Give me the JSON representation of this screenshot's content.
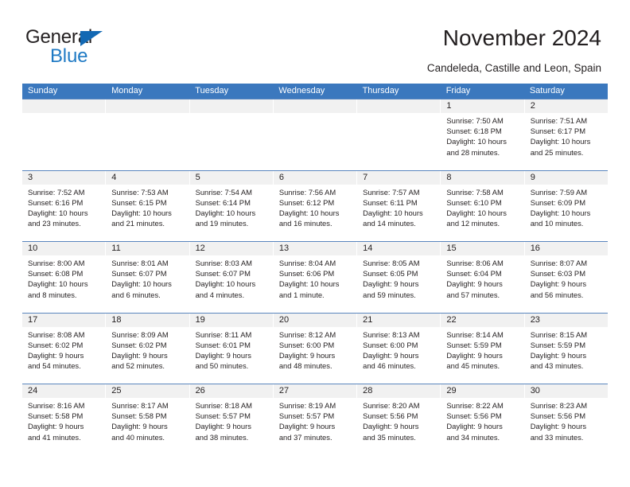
{
  "brand": {
    "name_part1": "General",
    "name_part2": "Blue",
    "triangle_color": "#1268b3",
    "blue_text_color": "#1f7ac4"
  },
  "header": {
    "title": "November 2024",
    "subtitle": "Candeleda, Castille and Leon, Spain"
  },
  "theme": {
    "header_row_bg": "#3b78be",
    "daynum_bg": "#f1f1f1",
    "week_separator": "#5a86be",
    "text_color": "#231f20"
  },
  "weekdays": [
    "Sunday",
    "Monday",
    "Tuesday",
    "Wednesday",
    "Thursday",
    "Friday",
    "Saturday"
  ],
  "weeks": [
    [
      {
        "day": "",
        "sunrise": "",
        "sunset": "",
        "daylight1": "",
        "daylight2": ""
      },
      {
        "day": "",
        "sunrise": "",
        "sunset": "",
        "daylight1": "",
        "daylight2": ""
      },
      {
        "day": "",
        "sunrise": "",
        "sunset": "",
        "daylight1": "",
        "daylight2": ""
      },
      {
        "day": "",
        "sunrise": "",
        "sunset": "",
        "daylight1": "",
        "daylight2": ""
      },
      {
        "day": "",
        "sunrise": "",
        "sunset": "",
        "daylight1": "",
        "daylight2": ""
      },
      {
        "day": "1",
        "sunrise": "Sunrise: 7:50 AM",
        "sunset": "Sunset: 6:18 PM",
        "daylight1": "Daylight: 10 hours",
        "daylight2": "and 28 minutes."
      },
      {
        "day": "2",
        "sunrise": "Sunrise: 7:51 AM",
        "sunset": "Sunset: 6:17 PM",
        "daylight1": "Daylight: 10 hours",
        "daylight2": "and 25 minutes."
      }
    ],
    [
      {
        "day": "3",
        "sunrise": "Sunrise: 7:52 AM",
        "sunset": "Sunset: 6:16 PM",
        "daylight1": "Daylight: 10 hours",
        "daylight2": "and 23 minutes."
      },
      {
        "day": "4",
        "sunrise": "Sunrise: 7:53 AM",
        "sunset": "Sunset: 6:15 PM",
        "daylight1": "Daylight: 10 hours",
        "daylight2": "and 21 minutes."
      },
      {
        "day": "5",
        "sunrise": "Sunrise: 7:54 AM",
        "sunset": "Sunset: 6:14 PM",
        "daylight1": "Daylight: 10 hours",
        "daylight2": "and 19 minutes."
      },
      {
        "day": "6",
        "sunrise": "Sunrise: 7:56 AM",
        "sunset": "Sunset: 6:12 PM",
        "daylight1": "Daylight: 10 hours",
        "daylight2": "and 16 minutes."
      },
      {
        "day": "7",
        "sunrise": "Sunrise: 7:57 AM",
        "sunset": "Sunset: 6:11 PM",
        "daylight1": "Daylight: 10 hours",
        "daylight2": "and 14 minutes."
      },
      {
        "day": "8",
        "sunrise": "Sunrise: 7:58 AM",
        "sunset": "Sunset: 6:10 PM",
        "daylight1": "Daylight: 10 hours",
        "daylight2": "and 12 minutes."
      },
      {
        "day": "9",
        "sunrise": "Sunrise: 7:59 AM",
        "sunset": "Sunset: 6:09 PM",
        "daylight1": "Daylight: 10 hours",
        "daylight2": "and 10 minutes."
      }
    ],
    [
      {
        "day": "10",
        "sunrise": "Sunrise: 8:00 AM",
        "sunset": "Sunset: 6:08 PM",
        "daylight1": "Daylight: 10 hours",
        "daylight2": "and 8 minutes."
      },
      {
        "day": "11",
        "sunrise": "Sunrise: 8:01 AM",
        "sunset": "Sunset: 6:07 PM",
        "daylight1": "Daylight: 10 hours",
        "daylight2": "and 6 minutes."
      },
      {
        "day": "12",
        "sunrise": "Sunrise: 8:03 AM",
        "sunset": "Sunset: 6:07 PM",
        "daylight1": "Daylight: 10 hours",
        "daylight2": "and 4 minutes."
      },
      {
        "day": "13",
        "sunrise": "Sunrise: 8:04 AM",
        "sunset": "Sunset: 6:06 PM",
        "daylight1": "Daylight: 10 hours",
        "daylight2": "and 1 minute."
      },
      {
        "day": "14",
        "sunrise": "Sunrise: 8:05 AM",
        "sunset": "Sunset: 6:05 PM",
        "daylight1": "Daylight: 9 hours",
        "daylight2": "and 59 minutes."
      },
      {
        "day": "15",
        "sunrise": "Sunrise: 8:06 AM",
        "sunset": "Sunset: 6:04 PM",
        "daylight1": "Daylight: 9 hours",
        "daylight2": "and 57 minutes."
      },
      {
        "day": "16",
        "sunrise": "Sunrise: 8:07 AM",
        "sunset": "Sunset: 6:03 PM",
        "daylight1": "Daylight: 9 hours",
        "daylight2": "and 56 minutes."
      }
    ],
    [
      {
        "day": "17",
        "sunrise": "Sunrise: 8:08 AM",
        "sunset": "Sunset: 6:02 PM",
        "daylight1": "Daylight: 9 hours",
        "daylight2": "and 54 minutes."
      },
      {
        "day": "18",
        "sunrise": "Sunrise: 8:09 AM",
        "sunset": "Sunset: 6:02 PM",
        "daylight1": "Daylight: 9 hours",
        "daylight2": "and 52 minutes."
      },
      {
        "day": "19",
        "sunrise": "Sunrise: 8:11 AM",
        "sunset": "Sunset: 6:01 PM",
        "daylight1": "Daylight: 9 hours",
        "daylight2": "and 50 minutes."
      },
      {
        "day": "20",
        "sunrise": "Sunrise: 8:12 AM",
        "sunset": "Sunset: 6:00 PM",
        "daylight1": "Daylight: 9 hours",
        "daylight2": "and 48 minutes."
      },
      {
        "day": "21",
        "sunrise": "Sunrise: 8:13 AM",
        "sunset": "Sunset: 6:00 PM",
        "daylight1": "Daylight: 9 hours",
        "daylight2": "and 46 minutes."
      },
      {
        "day": "22",
        "sunrise": "Sunrise: 8:14 AM",
        "sunset": "Sunset: 5:59 PM",
        "daylight1": "Daylight: 9 hours",
        "daylight2": "and 45 minutes."
      },
      {
        "day": "23",
        "sunrise": "Sunrise: 8:15 AM",
        "sunset": "Sunset: 5:59 PM",
        "daylight1": "Daylight: 9 hours",
        "daylight2": "and 43 minutes."
      }
    ],
    [
      {
        "day": "24",
        "sunrise": "Sunrise: 8:16 AM",
        "sunset": "Sunset: 5:58 PM",
        "daylight1": "Daylight: 9 hours",
        "daylight2": "and 41 minutes."
      },
      {
        "day": "25",
        "sunrise": "Sunrise: 8:17 AM",
        "sunset": "Sunset: 5:58 PM",
        "daylight1": "Daylight: 9 hours",
        "daylight2": "and 40 minutes."
      },
      {
        "day": "26",
        "sunrise": "Sunrise: 8:18 AM",
        "sunset": "Sunset: 5:57 PM",
        "daylight1": "Daylight: 9 hours",
        "daylight2": "and 38 minutes."
      },
      {
        "day": "27",
        "sunrise": "Sunrise: 8:19 AM",
        "sunset": "Sunset: 5:57 PM",
        "daylight1": "Daylight: 9 hours",
        "daylight2": "and 37 minutes."
      },
      {
        "day": "28",
        "sunrise": "Sunrise: 8:20 AM",
        "sunset": "Sunset: 5:56 PM",
        "daylight1": "Daylight: 9 hours",
        "daylight2": "and 35 minutes."
      },
      {
        "day": "29",
        "sunrise": "Sunrise: 8:22 AM",
        "sunset": "Sunset: 5:56 PM",
        "daylight1": "Daylight: 9 hours",
        "daylight2": "and 34 minutes."
      },
      {
        "day": "30",
        "sunrise": "Sunrise: 8:23 AM",
        "sunset": "Sunset: 5:56 PM",
        "daylight1": "Daylight: 9 hours",
        "daylight2": "and 33 minutes."
      }
    ]
  ]
}
